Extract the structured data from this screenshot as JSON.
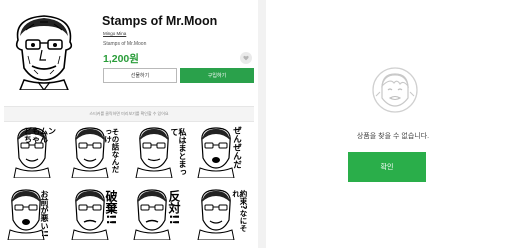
{
  "product": {
    "title": "Stamps of Mr.Moon",
    "author": "Mingo Mina",
    "subtitle": "Stamps of Mr.Moon",
    "price": "1,200원",
    "gift_label": "선물하기",
    "buy_label": "구입하기"
  },
  "notice": "스티커를 클릭하면 미리보기를 확인할 수 있어요",
  "stickers": [
    {
      "text": "どもムンちゃん"
    },
    {
      "text": "その話なんだっけ"
    },
    {
      "text": "私はまとまって"
    },
    {
      "text": "ぜんぜんだ"
    },
    {
      "text": "お前が悪い!!"
    },
    {
      "text": "破棄!!"
    },
    {
      "text": "反対!!"
    },
    {
      "text": "約束?なにそれ"
    }
  ],
  "not_found": {
    "message": "상품을 찾을 수 없습니다.",
    "ok_label": "확인"
  },
  "colors": {
    "accent_green": "#2aa14b",
    "price_green": "#2a9d3a"
  }
}
